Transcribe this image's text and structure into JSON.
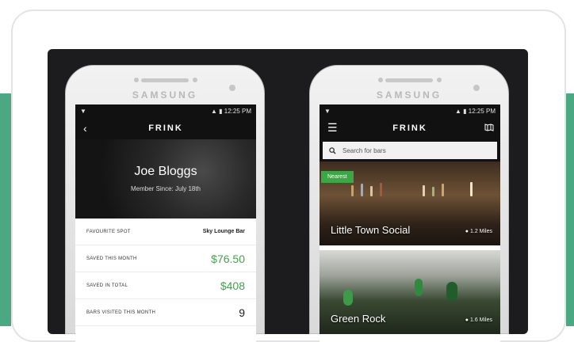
{
  "colors": {
    "accent_green": "#3aa844",
    "teal": "#4aa883",
    "panel": "#1c1c1f"
  },
  "phones": {
    "left": {
      "brand": "SAMSUNG",
      "status": {
        "left_icon": "signal-icon",
        "time": "12:25 PM"
      },
      "app_title": "FRINK",
      "back_icon": "back-arrow-icon",
      "profile": {
        "name": "Joe Bloggs",
        "member_since": "Member Since: July 18th"
      },
      "stats": [
        {
          "label": "FAVOURITE SPOT",
          "value": "Sky Lounge Bar"
        },
        {
          "label": "SAVED THIS MONTH",
          "value": "$76.50"
        },
        {
          "label": "SAVED IN TOTAL",
          "value": "$408"
        },
        {
          "label": "BARS VISITED THIS MONTH",
          "value": "9"
        }
      ]
    },
    "right": {
      "brand": "SAMSUNG",
      "status": {
        "time": "12:25 PM"
      },
      "app_title": "FRINK",
      "menu_icon": "hamburger-menu-icon",
      "map_icon": "map-icon",
      "search": {
        "placeholder": "Search for bars",
        "value": ""
      },
      "venues": [
        {
          "name": "Little Town Social",
          "distance": "1.2 Miles",
          "badge": "Nearest"
        },
        {
          "name": "Green Rock",
          "distance": "1.6 Miles"
        }
      ]
    }
  }
}
